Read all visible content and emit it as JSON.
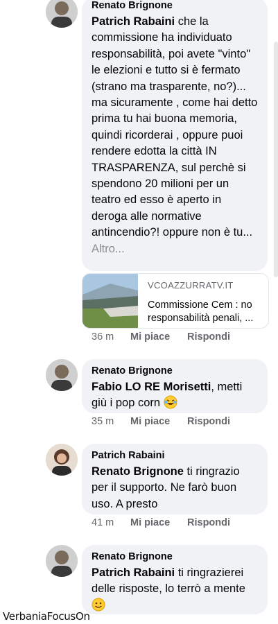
{
  "comments": [
    {
      "author": "Renato Brignone",
      "mention": "Patrich Rabaini",
      "text": " che la commissione ha individuato responsabilità, poi avete \"vinto\" le elezioni e tutto si è fermato (strano ma trasparente, no?)... ma sicuramente , come hai detto prima tu hai buona memoria, quindi ricorderai , oppure puoi rendere edotta la città IN TRASPARENZA, sul perchè si spendono 20 milioni per un teatro ed esso è aperto in deroga alle normative antincendio?! oppure non è tu...",
      "more": " Altro...",
      "time": "36 m",
      "like": "Mi piace",
      "reply": "Rispondi"
    },
    {
      "author": "Renato Brignone",
      "mention": "Fabio LO RE Morisetti",
      "text": ", metti giù i pop corn",
      "time": "35 m",
      "like": "Mi piace",
      "reply": "Rispondi"
    },
    {
      "author": "Patrich Rabaini",
      "mention": "Renato Brignone",
      "text": "  ti ringrazio per il supporto. Ne farò buon uso. A presto",
      "time": "41 m",
      "like": "Mi piace",
      "reply": "Rispondi"
    },
    {
      "author": "Renato Brignone",
      "mention": "Patrich Rabaini",
      "text": " ti ringrazierei delle risposte, lo terrò a mente"
    }
  ],
  "link_preview": {
    "domain": "VCOAZZURRATV.IT",
    "title": "Commissione Cem : no responsabilità penali, ..."
  },
  "watermark": "VerbaniaFocusOn",
  "icons": [
    "avatar-renato",
    "avatar-patrich",
    "laughing-emoji",
    "smile-emoji"
  ]
}
